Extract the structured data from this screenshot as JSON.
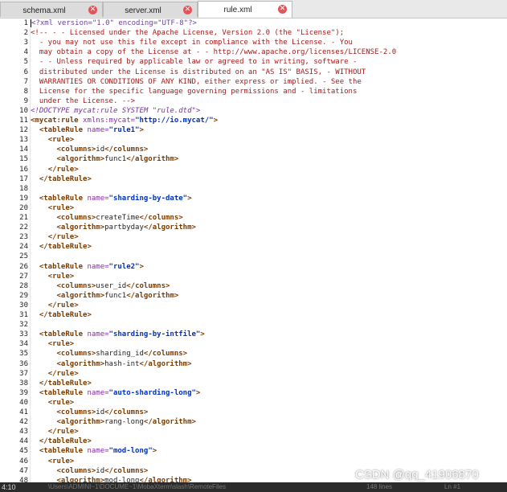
{
  "tabs": [
    {
      "label": "schema.xml",
      "active": false
    },
    {
      "label": "server.xml",
      "active": false
    },
    {
      "label": "rule.xml",
      "active": true
    }
  ],
  "editor": {
    "lines": [
      {
        "n": "1",
        "segs": [
          [
            "pi",
            "<?xml version=\"1.0\" encoding=\"UTF-8\"?>"
          ]
        ]
      },
      {
        "n": "2",
        "segs": [
          [
            "comment",
            "<!-- - - Licensed under the Apache License, Version 2.0 (the \"License\");"
          ]
        ]
      },
      {
        "n": "3",
        "segs": [
          [
            "comment",
            "  - you may not use this file except in compliance with the License. - You"
          ]
        ]
      },
      {
        "n": "4",
        "segs": [
          [
            "comment",
            "  may obtain a copy of the License at - - http://www.apache.org/licenses/LICENSE-2.0"
          ]
        ]
      },
      {
        "n": "5",
        "segs": [
          [
            "comment",
            "  - - Unless required by applicable law or agreed to in writing, software -"
          ]
        ]
      },
      {
        "n": "6",
        "segs": [
          [
            "comment",
            "  distributed under the License is distributed on an \"AS IS\" BASIS, - WITHOUT"
          ]
        ]
      },
      {
        "n": "7",
        "segs": [
          [
            "comment",
            "  WARRANTIES OR CONDITIONS OF ANY KIND, either express or implied. - See the"
          ]
        ]
      },
      {
        "n": "8",
        "segs": [
          [
            "comment",
            "  License for the specific language governing permissions and - limitations"
          ]
        ]
      },
      {
        "n": "9",
        "segs": [
          [
            "comment",
            "  under the License. -->"
          ]
        ]
      },
      {
        "n": "10",
        "segs": [
          [
            "doctype",
            "<!DOCTYPE mycat:rule SYSTEM \"rule.dtd\">"
          ]
        ]
      },
      {
        "n": "11",
        "segs": [
          [
            "tag",
            "<mycat:rule"
          ],
          [
            "attr",
            " xmlns:mycat="
          ],
          [
            "val",
            "\"http://io.mycat/\""
          ],
          [
            "tag",
            ">"
          ]
        ]
      },
      {
        "n": "12",
        "segs": [
          [
            "text",
            "  "
          ],
          [
            "tag",
            "<tableRule"
          ],
          [
            "attr",
            " name="
          ],
          [
            "val",
            "\"rule1\""
          ],
          [
            "tag",
            ">"
          ]
        ]
      },
      {
        "n": "13",
        "segs": [
          [
            "text",
            "    "
          ],
          [
            "tag",
            "<rule>"
          ]
        ]
      },
      {
        "n": "14",
        "segs": [
          [
            "text",
            "      "
          ],
          [
            "tag",
            "<columns>"
          ],
          [
            "text",
            "id"
          ],
          [
            "tag",
            "</columns>"
          ]
        ]
      },
      {
        "n": "15",
        "segs": [
          [
            "text",
            "      "
          ],
          [
            "tag",
            "<algorithm>"
          ],
          [
            "text",
            "func1"
          ],
          [
            "tag",
            "</algorithm>"
          ]
        ]
      },
      {
        "n": "16",
        "segs": [
          [
            "text",
            "    "
          ],
          [
            "tag",
            "</rule>"
          ]
        ]
      },
      {
        "n": "17",
        "segs": [
          [
            "text",
            "  "
          ],
          [
            "tag",
            "</tableRule>"
          ]
        ]
      },
      {
        "n": "18",
        "segs": []
      },
      {
        "n": "19",
        "segs": [
          [
            "text",
            "  "
          ],
          [
            "tag",
            "<tableRule"
          ],
          [
            "attr",
            " name="
          ],
          [
            "val",
            "\"sharding-by-date\""
          ],
          [
            "tag",
            ">"
          ]
        ]
      },
      {
        "n": "20",
        "segs": [
          [
            "text",
            "    "
          ],
          [
            "tag",
            "<rule>"
          ]
        ]
      },
      {
        "n": "21",
        "segs": [
          [
            "text",
            "      "
          ],
          [
            "tag",
            "<columns>"
          ],
          [
            "text",
            "createTime"
          ],
          [
            "tag",
            "</columns>"
          ]
        ]
      },
      {
        "n": "22",
        "segs": [
          [
            "text",
            "      "
          ],
          [
            "tag",
            "<algorithm>"
          ],
          [
            "text",
            "partbyday"
          ],
          [
            "tag",
            "</algorithm>"
          ]
        ]
      },
      {
        "n": "23",
        "segs": [
          [
            "text",
            "    "
          ],
          [
            "tag",
            "</rule>"
          ]
        ]
      },
      {
        "n": "24",
        "segs": [
          [
            "text",
            "  "
          ],
          [
            "tag",
            "</tableRule>"
          ]
        ]
      },
      {
        "n": "25",
        "segs": []
      },
      {
        "n": "26",
        "segs": [
          [
            "text",
            "  "
          ],
          [
            "tag",
            "<tableRule"
          ],
          [
            "attr",
            " name="
          ],
          [
            "val",
            "\"rule2\""
          ],
          [
            "tag",
            ">"
          ]
        ]
      },
      {
        "n": "27",
        "segs": [
          [
            "text",
            "    "
          ],
          [
            "tag",
            "<rule>"
          ]
        ]
      },
      {
        "n": "28",
        "segs": [
          [
            "text",
            "      "
          ],
          [
            "tag",
            "<columns>"
          ],
          [
            "text",
            "user_id"
          ],
          [
            "tag",
            "</columns>"
          ]
        ]
      },
      {
        "n": "29",
        "segs": [
          [
            "text",
            "      "
          ],
          [
            "tag",
            "<algorithm>"
          ],
          [
            "text",
            "func1"
          ],
          [
            "tag",
            "</algorithm>"
          ]
        ]
      },
      {
        "n": "30",
        "segs": [
          [
            "text",
            "    "
          ],
          [
            "tag",
            "</rule>"
          ]
        ]
      },
      {
        "n": "31",
        "segs": [
          [
            "text",
            "  "
          ],
          [
            "tag",
            "</tableRule>"
          ]
        ]
      },
      {
        "n": "32",
        "segs": []
      },
      {
        "n": "33",
        "segs": [
          [
            "text",
            "  "
          ],
          [
            "tag",
            "<tableRule"
          ],
          [
            "attr",
            " name="
          ],
          [
            "val",
            "\"sharding-by-intfile\""
          ],
          [
            "tag",
            ">"
          ]
        ]
      },
      {
        "n": "34",
        "segs": [
          [
            "text",
            "    "
          ],
          [
            "tag",
            "<rule>"
          ]
        ]
      },
      {
        "n": "35",
        "segs": [
          [
            "text",
            "      "
          ],
          [
            "tag",
            "<columns>"
          ],
          [
            "text",
            "sharding_id"
          ],
          [
            "tag",
            "</columns>"
          ]
        ]
      },
      {
        "n": "36",
        "segs": [
          [
            "text",
            "      "
          ],
          [
            "tag",
            "<algorithm>"
          ],
          [
            "text",
            "hash-int"
          ],
          [
            "tag",
            "</algorithm>"
          ]
        ]
      },
      {
        "n": "37",
        "segs": [
          [
            "text",
            "    "
          ],
          [
            "tag",
            "</rule>"
          ]
        ]
      },
      {
        "n": "38",
        "segs": [
          [
            "text",
            "  "
          ],
          [
            "tag",
            "</tableRule>"
          ]
        ]
      },
      {
        "n": "39",
        "segs": [
          [
            "text",
            "  "
          ],
          [
            "tag",
            "<tableRule"
          ],
          [
            "attr",
            " name="
          ],
          [
            "val",
            "\"auto-sharding-long\""
          ],
          [
            "tag",
            ">"
          ]
        ]
      },
      {
        "n": "40",
        "segs": [
          [
            "text",
            "    "
          ],
          [
            "tag",
            "<rule>"
          ]
        ]
      },
      {
        "n": "41",
        "segs": [
          [
            "text",
            "      "
          ],
          [
            "tag",
            "<columns>"
          ],
          [
            "text",
            "id"
          ],
          [
            "tag",
            "</columns>"
          ]
        ]
      },
      {
        "n": "42",
        "segs": [
          [
            "text",
            "      "
          ],
          [
            "tag",
            "<algorithm>"
          ],
          [
            "text",
            "rang-long"
          ],
          [
            "tag",
            "</algorithm>"
          ]
        ]
      },
      {
        "n": "43",
        "segs": [
          [
            "text",
            "    "
          ],
          [
            "tag",
            "</rule>"
          ]
        ]
      },
      {
        "n": "44",
        "segs": [
          [
            "text",
            "  "
          ],
          [
            "tag",
            "</tableRule>"
          ]
        ]
      },
      {
        "n": "45",
        "segs": [
          [
            "text",
            "  "
          ],
          [
            "tag",
            "<tableRule"
          ],
          [
            "attr",
            " name="
          ],
          [
            "val",
            "\"mod-long\""
          ],
          [
            "tag",
            ">"
          ]
        ]
      },
      {
        "n": "46",
        "segs": [
          [
            "text",
            "    "
          ],
          [
            "tag",
            "<rule>"
          ]
        ]
      },
      {
        "n": "47",
        "segs": [
          [
            "text",
            "      "
          ],
          [
            "tag",
            "<columns>"
          ],
          [
            "text",
            "id"
          ],
          [
            "tag",
            "</columns>"
          ]
        ]
      },
      {
        "n": "48",
        "segs": [
          [
            "text",
            "      "
          ],
          [
            "tag",
            "<algorithm>"
          ],
          [
            "text",
            "mod-long"
          ],
          [
            "tag",
            "</algorithm>"
          ]
        ]
      }
    ]
  },
  "statusbar": {
    "time": "4:10",
    "path": "\\Users\\ADMINI~1\\DOCUME~1\\MobaXterm\\slash\\RemoteFiles",
    "lines_count": "148 lines",
    "position": "Ln #1"
  },
  "watermark": "CSDN @qq_41906870",
  "colors": {
    "tag": "#7a3b00",
    "attr": "#8a2ba8",
    "value": "#0030c0",
    "comment": "#a61c1c",
    "close_button": "#e0565a"
  }
}
